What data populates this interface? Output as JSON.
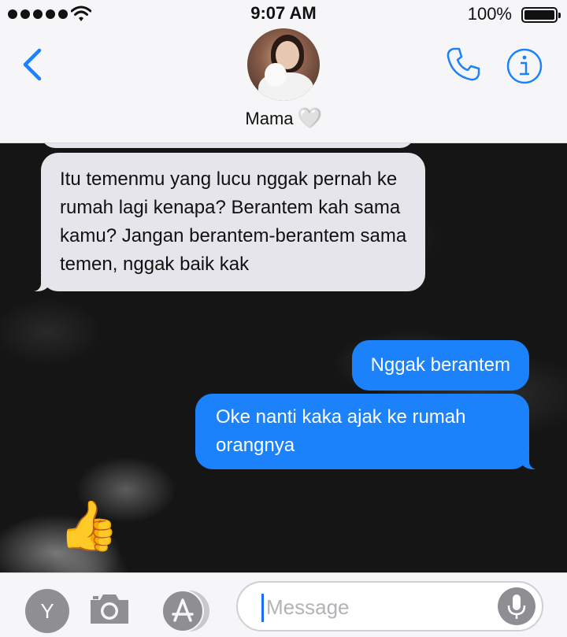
{
  "status_bar": {
    "time": "9:07 AM",
    "battery": "100%"
  },
  "header": {
    "contact_name": "Mama",
    "heart": "🤍",
    "back_icon": "chevron-left-icon",
    "call_icon": "phone-icon",
    "info_icon": "info-icon",
    "accent_color": "#1b82fb"
  },
  "messages": [
    {
      "direction": "incoming",
      "text": "Itu temenmu yang lucu nggak pernah ke rumah lagi kenapa? Berantem kah sama kamu? Jangan berantem-berantem sama temen, nggak baik kak"
    },
    {
      "direction": "outgoing",
      "text": "Nggak berantem"
    },
    {
      "direction": "outgoing",
      "text": "Oke nanti kaka ajak ke rumah orangnya"
    },
    {
      "direction": "incoming",
      "text": "👍"
    }
  ],
  "input_bar": {
    "y_button": "Y",
    "placeholder": "Message",
    "camera_icon": "camera-icon",
    "appstore_icon": "app-store-icon",
    "mic_icon": "microphone-icon"
  },
  "colors": {
    "incoming_bubble": "#e6e5eb",
    "outgoing_bubble": "#1b82fb"
  }
}
